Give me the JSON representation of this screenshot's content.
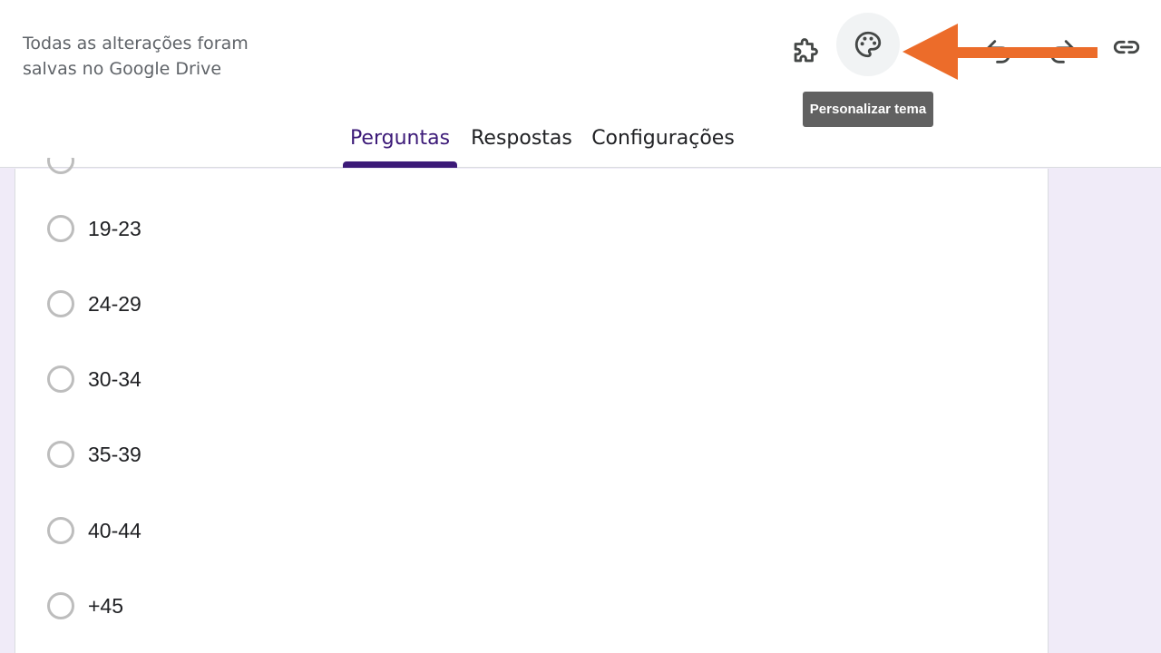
{
  "header": {
    "save_status_line1": "Todas as alterações foram",
    "save_status_line2": "salvas no Google Drive",
    "icons": [
      "puzzle-icon",
      "palette-icon",
      "undo-icon",
      "redo-icon",
      "link-icon"
    ],
    "tooltip": "Personalizar tema"
  },
  "tabs": [
    {
      "label": "Perguntas",
      "selected": true
    },
    {
      "label": "Respostas",
      "selected": false
    },
    {
      "label": "Configurações",
      "selected": false
    }
  ],
  "options": [
    "19-23",
    "24-29",
    "30-34",
    "35-39",
    "40-44",
    "+45"
  ],
  "colors": {
    "accent": "#3c1a78",
    "background": "#f0ebf8",
    "annotation_arrow": "#ec6c2a",
    "tooltip_bg": "#616161"
  }
}
